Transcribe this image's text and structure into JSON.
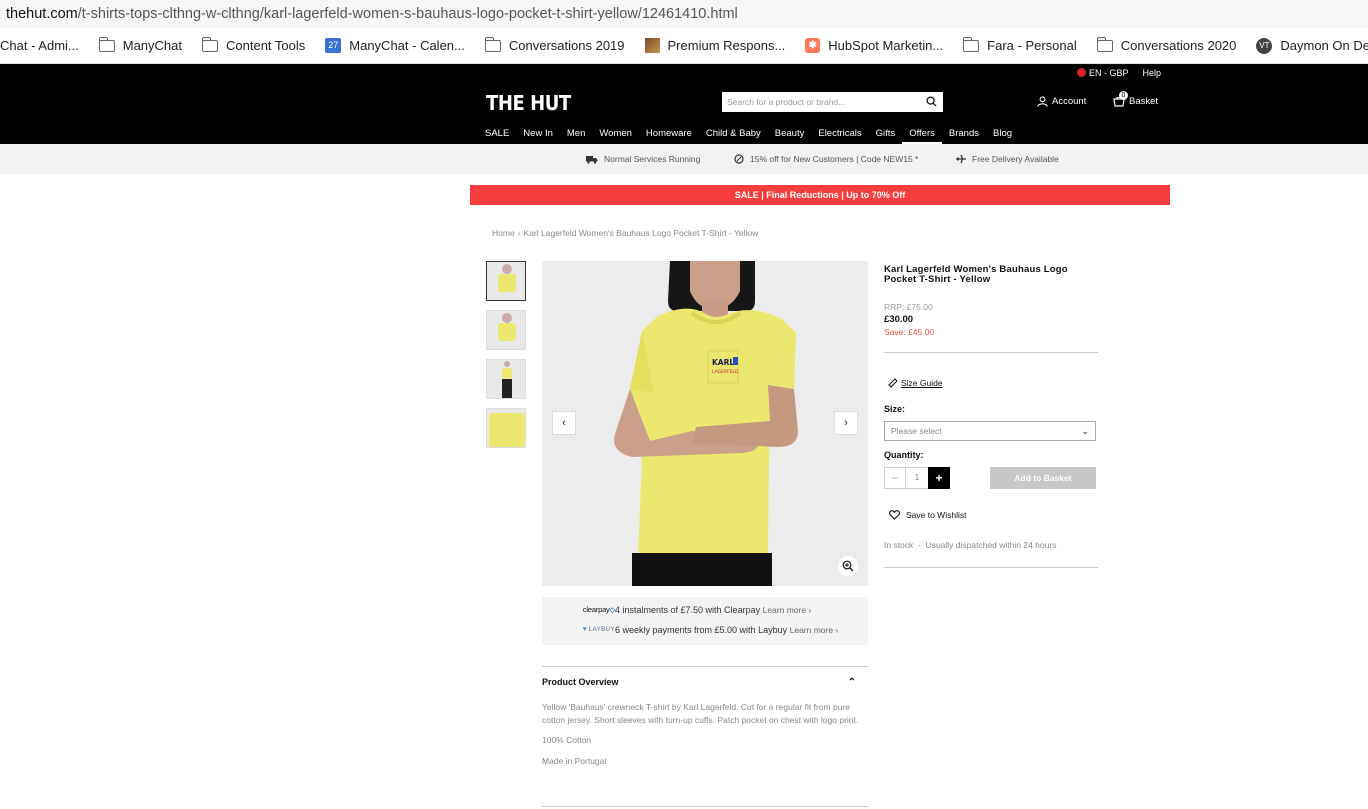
{
  "browser": {
    "url_host": "thehut.com",
    "url_path": "/t-shirts-tops-clthng-w-clthng/karl-lagerfeld-women-s-bauhaus-logo-pocket-t-shirt-yellow/12461410.html",
    "bookmarks": [
      "Chat - Admi...",
      "ManyChat",
      "Content Tools",
      "ManyChat - Calen...",
      "Conversations 2019",
      "Premium Respons...",
      "HubSpot Marketin...",
      "Fara - Personal",
      "Conversations 2020",
      "Daymon On Dema..."
    ],
    "calendar_day": "27",
    "more": "»"
  },
  "header": {
    "locale": "EN - GBP",
    "help": "Help",
    "logo": "THE HUT",
    "search_placeholder": "Search for a product or brand...",
    "account": "Account",
    "basket": "Basket",
    "basket_count": "0",
    "nav": [
      "SALE",
      "New In",
      "Men",
      "Women",
      "Homeware",
      "Child & Baby",
      "Beauty",
      "Electricals",
      "Gifts",
      "Offers",
      "Brands",
      "Blog"
    ]
  },
  "usp": {
    "services": "Normal Services Running",
    "discount": "15% off for New Customers | Code NEW15 *",
    "delivery": "Free Delivery Available"
  },
  "sale_banner": "SALE | Final Reductions | Up to 70% Off",
  "breadcrumb": {
    "home": "Home",
    "sep": "›",
    "current": "Karl Lagerfeld Women's Bauhaus Logo Pocket T-Shirt - Yellow"
  },
  "gallery": {
    "prev": "‹",
    "next": "›"
  },
  "payments": {
    "clearpay_logo": "clearpay",
    "clearpay_text": "4 instalments of £7.50 with Clearpay",
    "laybuy_logo": "LAYBUY",
    "laybuy_text": "6 weekly payments from £5.00 with Laybuy",
    "learn_more": "Learn more ›"
  },
  "overview": {
    "heading": "Product Overview",
    "toggle": "⌃",
    "description": "Yellow 'Bauhaus' crewneck T-shirt by Karl Lagerfeld. Cut for a regular fit from pure cotton jersey. Short sleeves with turn-up cuffs. Patch pocket on chest with logo print.",
    "material": "100% Cotton",
    "origin": "Made in Portugal"
  },
  "product": {
    "title": "Karl Lagerfeld Women's Bauhaus Logo Pocket T-Shirt - Yellow",
    "rrp": "RRP: £75.00",
    "price": "£30.00",
    "save": "Save: £45.00",
    "size_guide": "Size Guide",
    "size_label": "Size:",
    "size_placeholder": "Please select",
    "quantity_label": "Quantity:",
    "quantity": "1",
    "minus": "−",
    "plus": "+",
    "add_to_basket": "Add to Basket",
    "wishlist": "Save to Wishlist",
    "stock": "In stock  -  Usually dispatched within 24 hours",
    "logo_print": "KARL LAGERFELD"
  },
  "colors": {
    "accent_red": "#f73d3d",
    "save_red": "#e1523d",
    "tee_yellow": "#ece86f"
  }
}
